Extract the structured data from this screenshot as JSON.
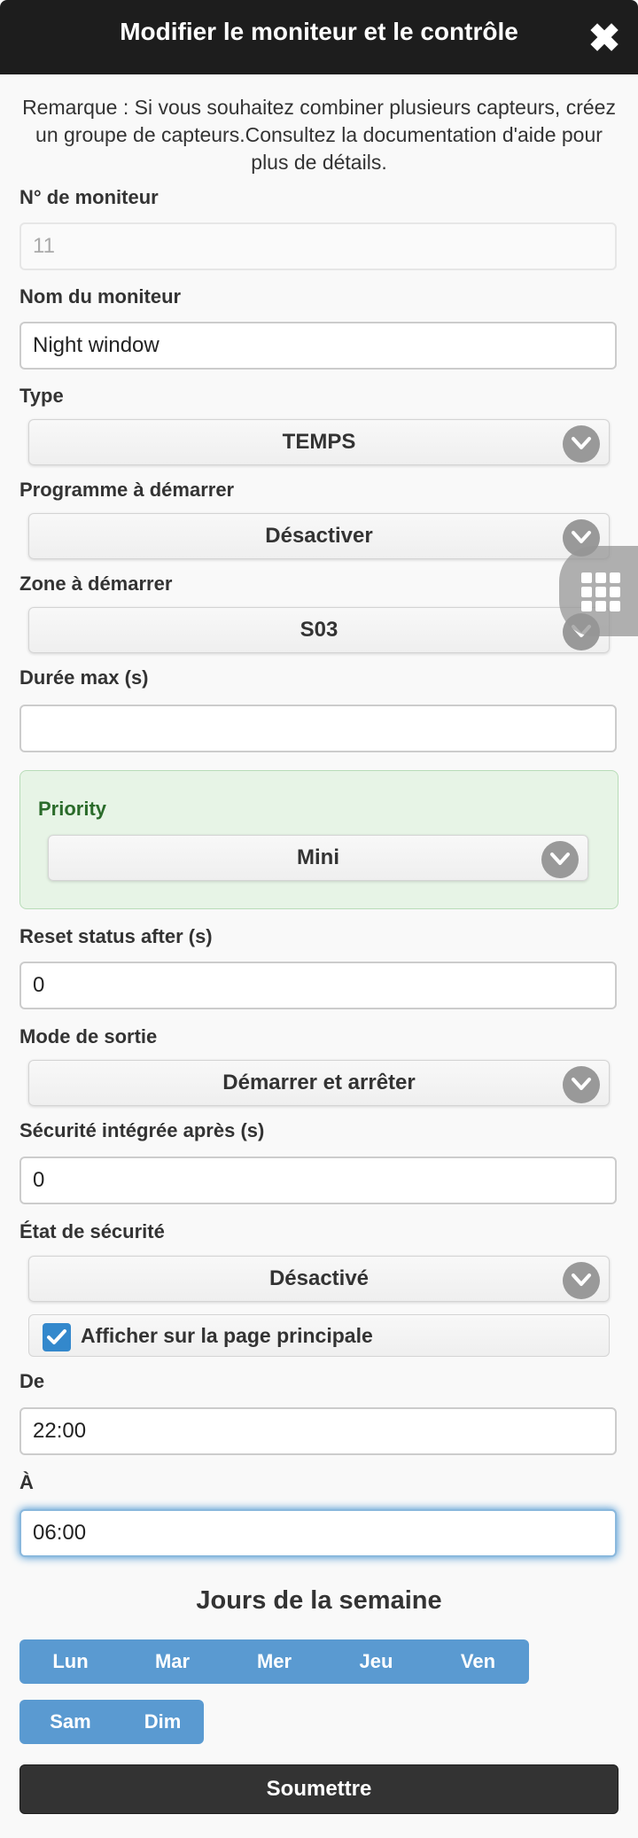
{
  "header": {
    "title": "Modifier le moniteur et le contrôle",
    "close_symbol": "✖"
  },
  "note": "Remarque : Si vous souhaitez combiner plusieurs capteurs, créez un groupe de capteurs.Consultez la documentation d'aide pour plus de détails.",
  "fields": {
    "monitor_id": {
      "label": "N° de moniteur",
      "value": "11"
    },
    "monitor_name": {
      "label": "Nom du moniteur",
      "value": "Night window"
    },
    "type": {
      "label": "Type",
      "value": "TEMPS"
    },
    "program": {
      "label": "Programme à démarrer",
      "value": "Désactiver"
    },
    "zone": {
      "label": "Zone à démarrer",
      "value": "S03"
    },
    "max_duration": {
      "label": "Durée max (s)",
      "value": ""
    },
    "priority": {
      "label": "Priority",
      "value": "Mini"
    },
    "reset_status": {
      "label": "Reset status after (s)",
      "value": "0"
    },
    "output_mode": {
      "label": "Mode de sortie",
      "value": "Démarrer et arrêter"
    },
    "failsafe_after": {
      "label": "Sécurité intégrée après (s)",
      "value": "0"
    },
    "failsafe_state": {
      "label": "État de sécurité",
      "value": "Désactivé"
    },
    "show_main": {
      "label": "Afficher sur la page principale",
      "checked": true
    },
    "from": {
      "label": "De",
      "value": "22:00"
    },
    "to": {
      "label": "À",
      "value": "06:00"
    }
  },
  "weekdays": {
    "heading": "Jours de la semaine",
    "row1": [
      "Lun",
      "Mar",
      "Mer",
      "Jeu",
      "Ven"
    ],
    "row2": [
      "Sam",
      "Dim"
    ]
  },
  "submit_label": "Soumettre",
  "colors": {
    "header": "#1d1d1d",
    "accent": "#3388cc",
    "day_buttons": "#5a9ad1",
    "priority_bg": "#e7f4e6"
  }
}
